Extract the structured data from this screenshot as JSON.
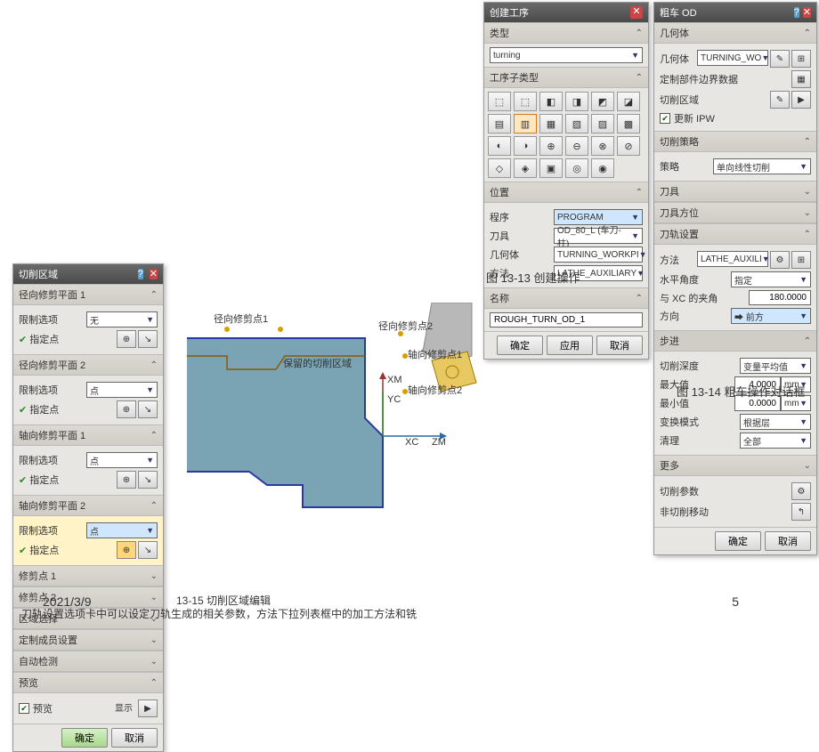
{
  "footer": {
    "date": "2021/3/9",
    "page": "5",
    "cap1315": "13-15  切削区域编辑",
    "note": "刀轨设置选项卡中可以设定刀轨生成的相关参数，方法下拉列表框中的加工方法和铣"
  },
  "captions": {
    "c1313": "图 13-13  创建操作",
    "c1314": "图 13-14  粗车操作对话框"
  },
  "dlgCut": {
    "title": "切削区域",
    "sec_r1": "径向修剪平面 1",
    "sec_r2": "径向修剪平面 2",
    "sec_a1": "轴向修剪平面 1",
    "sec_a2": "轴向修剪平面 2",
    "limitLabel": "限制选项",
    "specify": "指定点",
    "optNone": "无",
    "optPoint": "点",
    "sec_tp1": "修剪点 1",
    "sec_tp2": "修剪点 2",
    "sec_region": "区域选择",
    "sec_custom": "定制成员设置",
    "sec_auto": "自动检测",
    "sec_preview": "预览",
    "previewChk": "预览",
    "displayBtn": "显示",
    "ok": "确定",
    "cancel": "取消"
  },
  "dlgCreate": {
    "title": "创建工序",
    "typeLabel": "类型",
    "typeVal": "turning",
    "subtypeLabel": "工序子类型",
    "posLabel": "位置",
    "progLabel": "程序",
    "progVal": "PROGRAM",
    "toolLabel": "刀具",
    "toolVal": "OD_80_L (车刀-柱)",
    "geomLabel": "几何体",
    "geomVal": "TURNING_WORKPI",
    "methodLabel": "方法",
    "methodVal": "LATHE_AUXILIARY",
    "nameLabel": "名称",
    "nameVal": "ROUGH_TURN_OD_1",
    "ok": "确定",
    "apply": "应用",
    "cancel": "取消"
  },
  "dlgRough": {
    "title": "粗车 OD",
    "geomHdr": "几何体",
    "geomLbl": "几何体",
    "geomVal": "TURNING_WO",
    "custBound": "定制部件边界数据",
    "cutArea": "切削区域",
    "updIPW": "更新 IPW",
    "stratHdr": "切削策略",
    "stratLbl": "策略",
    "stratVal": "单向线性切削",
    "toolHdr": "刀具",
    "toolOrient": "刀具方位",
    "pathHdr": "刀轨设置",
    "methodLbl": "方法",
    "methodVal": "LATHE_AUXILI",
    "levelAngLbl": "水平角度",
    "levelAngVal": "指定",
    "xcAngLbl": "与 XC 的夹角",
    "xcAngVal": "180.0000",
    "dirLbl": "方向",
    "dirVal": "➡ 前方",
    "stepHdr": "步进",
    "cutDepLbl": "切削深度",
    "cutDepVal": "变量平均值",
    "maxLbl": "最大值",
    "maxVal": "4.0000",
    "unit": "mm",
    "minLbl": "最小值",
    "minVal": "0.0000",
    "chgModeLbl": "变换模式",
    "chgModeVal": "根据层",
    "cleanLbl": "清理",
    "cleanVal": "全部",
    "moreHdr": "更多",
    "cutParam": "切削参数",
    "nonCut": "非切削移动",
    "ok": "确定",
    "cancel": "取消"
  },
  "diagram": {
    "rTrim1": "径向修剪点1",
    "rTrim2": "径向修剪点2",
    "aTrim1": "轴向修剪点1",
    "aTrim2": "轴向修剪点2",
    "region": "保留的切削区域",
    "xm": "XM",
    "yc": "YC",
    "xc": "XC",
    "zm": "ZM"
  }
}
